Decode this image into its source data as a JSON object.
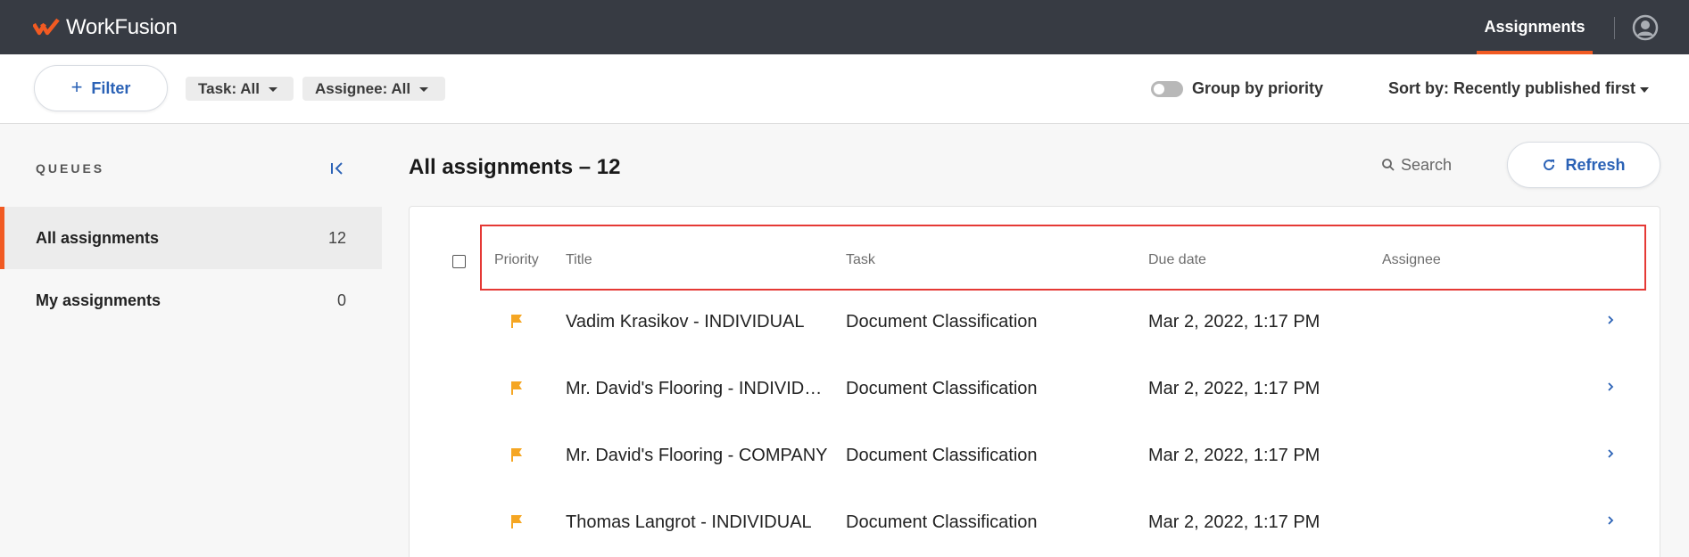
{
  "header": {
    "app_name": "WorkFusion",
    "nav_active": "Assignments",
    "brand_color": "#f15a22",
    "header_bg": "#373b43"
  },
  "filterbar": {
    "filter_label": "Filter",
    "task_chip": "Task: All",
    "assignee_chip": "Assignee: All",
    "group_by_label": "Group by priority",
    "group_by_enabled": false,
    "sort_label": "Sort by: Recently published first"
  },
  "sidebar": {
    "section_label": "QUEUES",
    "items": [
      {
        "label": "All assignments",
        "count": "12",
        "active": true
      },
      {
        "label": "My assignments",
        "count": "0",
        "active": false
      }
    ]
  },
  "main": {
    "title": "All assignments – 12",
    "search_placeholder": "Search",
    "refresh_label": "Refresh",
    "columns": [
      "Priority",
      "Title",
      "Task",
      "Due date",
      "Assignee"
    ],
    "rows": [
      {
        "priority": "flag-icon",
        "title": "Vadim Krasikov - INDIVIDUAL",
        "task": "Document Classification",
        "due": "Mar 2, 2022, 1:17 PM",
        "assignee": ""
      },
      {
        "priority": "flag-icon",
        "title": "Mr. David's Flooring - INDIVID…",
        "task": "Document Classification",
        "due": "Mar 2, 2022, 1:17 PM",
        "assignee": ""
      },
      {
        "priority": "flag-icon",
        "title": "Mr. David's Flooring - COMPANY",
        "task": "Document Classification",
        "due": "Mar 2, 2022, 1:17 PM",
        "assignee": ""
      },
      {
        "priority": "flag-icon",
        "title": "Thomas Langrot - INDIVIDUAL",
        "task": "Document Classification",
        "due": "Mar 2, 2022, 1:17 PM",
        "assignee": ""
      }
    ],
    "flag_color": "#f5a623",
    "link_color": "#2b62b6"
  }
}
